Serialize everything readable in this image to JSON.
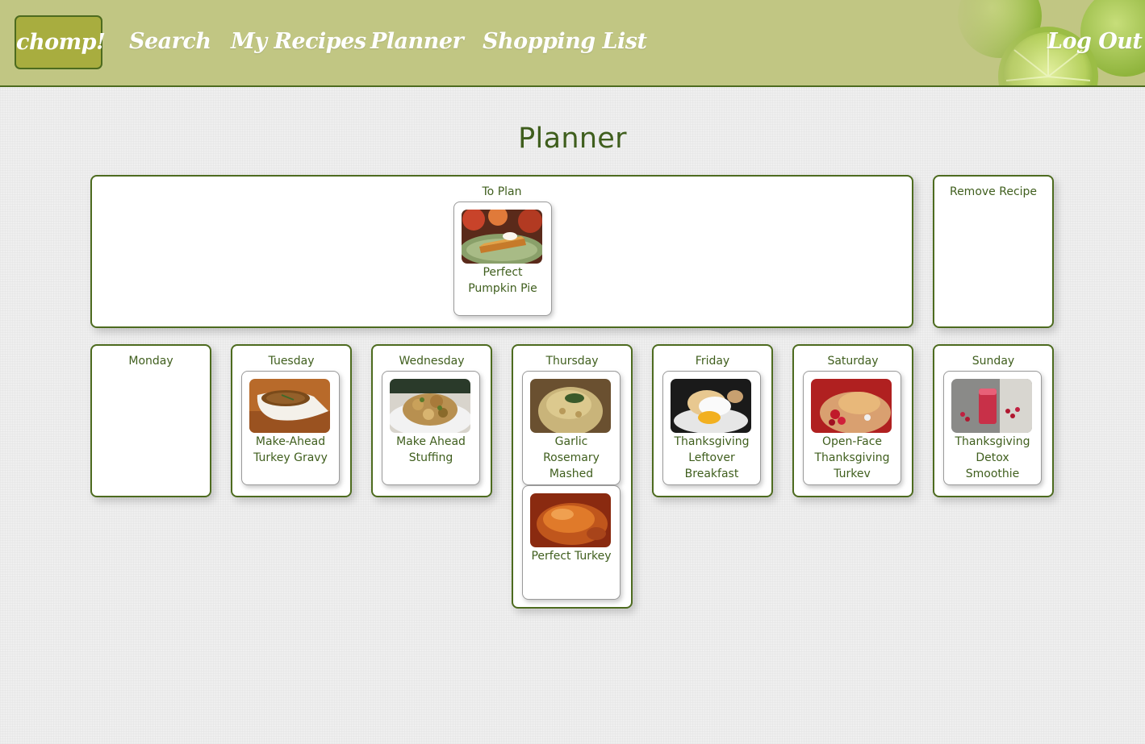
{
  "navbar": {
    "brand": "chomp!",
    "links": [
      "Search",
      "My Recipes",
      "Planner",
      "Shopping List"
    ],
    "logout": "Log Out"
  },
  "page": {
    "title": "Planner"
  },
  "to_plan": {
    "title": "To Plan",
    "recipes": [
      {
        "name": "Perfect Pumpkin Pie",
        "image": "pumpkin-pie-photo"
      }
    ]
  },
  "remove": {
    "title": "Remove Recipe"
  },
  "week": {
    "monday": {
      "label": "Monday",
      "recipes": []
    },
    "tuesday": {
      "label": "Tuesday",
      "recipes": [
        {
          "name": "Make-Ahead Turkey Gravy",
          "image": "gravy-photo"
        }
      ]
    },
    "wednesday": {
      "label": "Wednesday",
      "recipes": [
        {
          "name": "Make Ahead Stuffing",
          "image": "stuffing-photo"
        }
      ]
    },
    "thursday": {
      "label": "Thursday",
      "recipes": [
        {
          "name": "Garlic Rosemary Mashed",
          "image": "mashed-potatoes-photo"
        },
        {
          "name": "Perfect Turkey",
          "image": "roast-turkey-photo"
        }
      ]
    },
    "friday": {
      "label": "Friday",
      "recipes": [
        {
          "name": "Thanksgiving Leftover Breakfast",
          "image": "leftover-breakfast-photo"
        }
      ]
    },
    "saturday": {
      "label": "Saturday",
      "recipes": [
        {
          "name": "Open-Face Thanksgiving Turkev",
          "image": "open-face-turkey-photo"
        }
      ]
    },
    "sunday": {
      "label": "Sunday",
      "recipes": [
        {
          "name": "Thanksgiving Detox Smoothie",
          "image": "detox-smoothie-photo"
        }
      ]
    }
  },
  "colors": {
    "navbar_bg": "#c1c683",
    "brand_bg": "#a8ad3f",
    "accent_green": "#4d6b1f",
    "text_green": "#3f5e1d",
    "page_bg": "#efefef"
  }
}
